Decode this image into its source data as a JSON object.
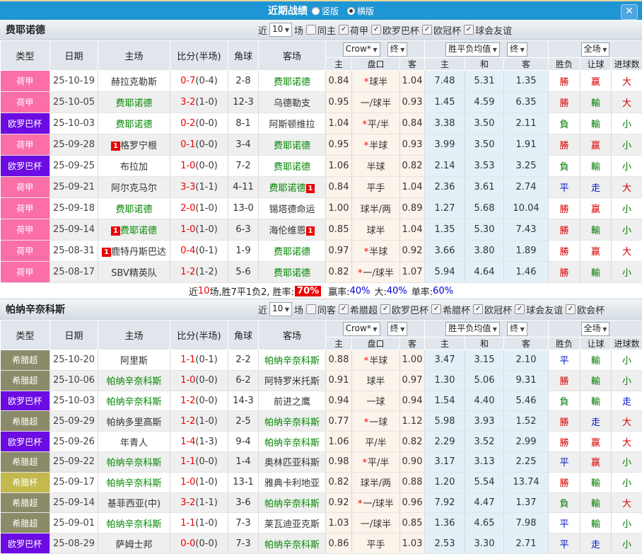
{
  "titlebar": {
    "title": "近期战绩",
    "radios": [
      {
        "label": "竖版",
        "selected": false
      },
      {
        "label": "横版",
        "selected": true
      }
    ],
    "close_icon": "✕"
  },
  "table_header": {
    "type": "类型",
    "date": "日期",
    "home": "主场",
    "score": "比分(半场)",
    "corner": "角球",
    "away": "客场",
    "odds_source_dd": "Crow*",
    "odds_final_dd": "终",
    "avg_dd": "胜平负均值",
    "avg_final_dd": "终",
    "scope_dd": "全场",
    "odds_home": "主",
    "odds_hcap": "盘口",
    "odds_away": "客",
    "avg_home": "主",
    "avg_draw": "和",
    "avg_away": "客",
    "res_wdl": "胜负",
    "res_hcap": "让球",
    "res_goals": "进球数"
  },
  "colors": {
    "topbar": "#2095d3",
    "league_colors": {
      "荷甲": "#fb6ea8",
      "欧罗巴杯": "#6c0ce2",
      "希腊超": "#8b8b69",
      "希腊杯": "#c3b94d"
    },
    "result_colors": {
      "w": "#d40000",
      "l": "#007a00",
      "d": "#0014cc"
    },
    "team_green": "#008800",
    "score_red": "#f00000"
  },
  "sections": [
    {
      "team": "费耶诺德",
      "filter": {
        "near": "近",
        "count": "10",
        "games": "场",
        "same": "同主",
        "same_checked": false,
        "leagues": [
          "荷甲",
          "欧罗巴杯",
          "欧冠杯",
          "球会友谊"
        ]
      },
      "rows": [
        {
          "league": "荷甲",
          "date": "25-10-19",
          "home": "赫拉克勒斯",
          "ft": "0-7",
          "ht": "(0-4)",
          "cr": "2-8",
          "away": "费耶诺德",
          "ag": true,
          "o": [
            "0.84",
            "球半",
            "1.04"
          ],
          "st": true,
          "a": [
            "7.48",
            "5.31",
            "1.35"
          ],
          "r": [
            [
              "勝",
              "w"
            ],
            [
              "赢",
              "w"
            ],
            [
              "大",
              "w"
            ]
          ]
        },
        {
          "league": "荷甲",
          "date": "25-10-05",
          "home": "费耶诺德",
          "hg": true,
          "ft": "3-2",
          "ht": "(1-0)",
          "cr": "12-3",
          "away": "乌德勒支",
          "o": [
            "0.95",
            "一/球半",
            "0.93"
          ],
          "a": [
            "1.45",
            "4.59",
            "6.35"
          ],
          "r": [
            [
              "勝",
              "w"
            ],
            [
              "輸",
              "l"
            ],
            [
              "大",
              "w"
            ]
          ]
        },
        {
          "league": "欧罗巴杯",
          "date": "25-10-03",
          "home": "费耶诺德",
          "hg": true,
          "ft": "0-2",
          "ht": "(0-0)",
          "cr": "8-1",
          "away": "阿斯顿维拉",
          "o": [
            "1.04",
            "平/半",
            "0.84"
          ],
          "st": true,
          "a": [
            "3.38",
            "3.50",
            "2.11"
          ],
          "r": [
            [
              "負",
              "l"
            ],
            [
              "輸",
              "l"
            ],
            [
              "小",
              "l"
            ]
          ]
        },
        {
          "league": "荷甲",
          "date": "25-09-28",
          "home": "格罗宁根",
          "hb": "1",
          "ft": "0-1",
          "ht": "(0-0)",
          "cr": "3-4",
          "away": "费耶诺德",
          "ag": true,
          "o": [
            "0.95",
            "半球",
            "0.93"
          ],
          "st": true,
          "a": [
            "3.99",
            "3.50",
            "1.91"
          ],
          "r": [
            [
              "勝",
              "w"
            ],
            [
              "赢",
              "w"
            ],
            [
              "小",
              "l"
            ]
          ]
        },
        {
          "league": "欧罗巴杯",
          "date": "25-09-25",
          "home": "布拉加",
          "ft": "1-0",
          "ht": "(0-0)",
          "cr": "7-2",
          "away": "费耶诺德",
          "ag": true,
          "o": [
            "1.06",
            "半球",
            "0.82"
          ],
          "a": [
            "2.14",
            "3.53",
            "3.25"
          ],
          "r": [
            [
              "負",
              "l"
            ],
            [
              "輸",
              "l"
            ],
            [
              "小",
              "l"
            ]
          ]
        },
        {
          "league": "荷甲",
          "date": "25-09-21",
          "home": "阿尔克马尔",
          "ft": "3-3",
          "ht": "(1-1)",
          "cr": "4-11",
          "away": "费耶诺德",
          "ag": true,
          "ab": "1",
          "o": [
            "0.84",
            "平手",
            "1.04"
          ],
          "a": [
            "2.36",
            "3.61",
            "2.74"
          ],
          "r": [
            [
              "平",
              "d"
            ],
            [
              "走",
              "d"
            ],
            [
              "大",
              "w"
            ]
          ]
        },
        {
          "league": "荷甲",
          "date": "25-09-18",
          "home": "费耶诺德",
          "hg": true,
          "ft": "2-0",
          "ht": "(1-0)",
          "cr": "13-0",
          "away": "锡塔德命运",
          "o": [
            "1.00",
            "球半/两",
            "0.89"
          ],
          "a": [
            "1.27",
            "5.68",
            "10.04"
          ],
          "r": [
            [
              "勝",
              "w"
            ],
            [
              "赢",
              "w"
            ],
            [
              "小",
              "l"
            ]
          ]
        },
        {
          "league": "荷甲",
          "date": "25-09-14",
          "home": "费耶诺德",
          "hg": true,
          "hb": "1",
          "ft": "1-0",
          "ht": "(1-0)",
          "cr": "6-3",
          "away": "海伦维恩",
          "ab": "1",
          "o": [
            "0.85",
            "球半",
            "1.04"
          ],
          "a": [
            "1.35",
            "5.30",
            "7.43"
          ],
          "r": [
            [
              "勝",
              "w"
            ],
            [
              "輸",
              "l"
            ],
            [
              "小",
              "l"
            ]
          ]
        },
        {
          "league": "荷甲",
          "date": "25-08-31",
          "home": "鹿特丹斯巴达",
          "hb": "1",
          "ft": "0-4",
          "ht": "(0-1)",
          "cr": "1-9",
          "away": "费耶诺德",
          "ag": true,
          "o": [
            "0.97",
            "半球",
            "0.92"
          ],
          "st": true,
          "a": [
            "3.66",
            "3.80",
            "1.89"
          ],
          "r": [
            [
              "勝",
              "w"
            ],
            [
              "赢",
              "w"
            ],
            [
              "大",
              "w"
            ]
          ]
        },
        {
          "league": "荷甲",
          "date": "25-08-17",
          "home": "SBV精英队",
          "ft": "1-2",
          "ht": "(1-2)",
          "cr": "5-6",
          "away": "费耶诺德",
          "ag": true,
          "o": [
            "0.82",
            "一/球半",
            "1.07"
          ],
          "st": true,
          "a": [
            "5.94",
            "4.64",
            "1.46"
          ],
          "r": [
            [
              "勝",
              "w"
            ],
            [
              "輸",
              "l"
            ],
            [
              "小",
              "l"
            ]
          ]
        }
      ],
      "summary": {
        "near": "近",
        "count": "10",
        "mid": "场,胜7平1负2, 胜率:",
        "rate": "70%",
        "pairs": [
          {
            "label": "赢率:",
            "value": "40%"
          },
          {
            "label": "大:",
            "value": "40%"
          },
          {
            "label": "单率:",
            "value": "60%"
          }
        ]
      }
    },
    {
      "team": "帕纳辛奈科斯",
      "filter": {
        "near": "近",
        "count": "10",
        "games": "场",
        "same": "同客",
        "same_checked": false,
        "leagues": [
          "希腊超",
          "欧罗巴杯",
          "希腊杯",
          "欧冠杯",
          "球会友谊",
          "欧会杯"
        ]
      },
      "rows": [
        {
          "league": "希腊超",
          "date": "25-10-20",
          "home": "阿里斯",
          "ft": "1-1",
          "ht": "(0-1)",
          "cr": "2-2",
          "away": "帕纳辛奈科斯",
          "ag": true,
          "o": [
            "0.88",
            "半球",
            "1.00"
          ],
          "st": true,
          "a": [
            "3.47",
            "3.15",
            "2.10"
          ],
          "r": [
            [
              "平",
              "d"
            ],
            [
              "輸",
              "l"
            ],
            [
              "小",
              "l"
            ]
          ]
        },
        {
          "league": "希腊超",
          "date": "25-10-06",
          "home": "帕纳辛奈科斯",
          "hg": true,
          "ft": "1-0",
          "ht": "(0-0)",
          "cr": "6-2",
          "away": "阿特罗米托斯",
          "o": [
            "0.91",
            "球半",
            "0.97"
          ],
          "a": [
            "1.30",
            "5.06",
            "9.31"
          ],
          "r": [
            [
              "勝",
              "w"
            ],
            [
              "輸",
              "l"
            ],
            [
              "小",
              "l"
            ]
          ]
        },
        {
          "league": "欧罗巴杯",
          "date": "25-10-03",
          "home": "帕纳辛奈科斯",
          "hg": true,
          "ft": "1-2",
          "ht": "(0-0)",
          "cr": "14-3",
          "away": "前进之鹰",
          "o": [
            "0.94",
            "一球",
            "0.94"
          ],
          "a": [
            "1.54",
            "4.40",
            "5.46"
          ],
          "r": [
            [
              "負",
              "l"
            ],
            [
              "輸",
              "l"
            ],
            [
              "走",
              "d"
            ]
          ]
        },
        {
          "league": "希腊超",
          "date": "25-09-29",
          "home": "帕纳多里高斯",
          "ft": "1-2",
          "ht": "(1-0)",
          "cr": "2-5",
          "away": "帕纳辛奈科斯",
          "ag": true,
          "o": [
            "0.77",
            "一球",
            "1.12"
          ],
          "st": true,
          "a": [
            "5.98",
            "3.93",
            "1.52"
          ],
          "r": [
            [
              "勝",
              "w"
            ],
            [
              "走",
              "d"
            ],
            [
              "大",
              "w"
            ]
          ]
        },
        {
          "league": "欧罗巴杯",
          "date": "25-09-26",
          "home": "年青人",
          "ft": "1-4",
          "ht": "(1-3)",
          "cr": "9-4",
          "away": "帕纳辛奈科斯",
          "ag": true,
          "o": [
            "1.06",
            "平/半",
            "0.82"
          ],
          "a": [
            "2.29",
            "3.52",
            "2.99"
          ],
          "r": [
            [
              "勝",
              "w"
            ],
            [
              "赢",
              "w"
            ],
            [
              "大",
              "w"
            ]
          ]
        },
        {
          "league": "希腊超",
          "date": "25-09-22",
          "home": "帕纳辛奈科斯",
          "hg": true,
          "ft": "1-1",
          "ht": "(0-0)",
          "cr": "1-4",
          "away": "奥林匹亚科斯",
          "o": [
            "0.98",
            "平/半",
            "0.90"
          ],
          "st": true,
          "a": [
            "3.17",
            "3.13",
            "2.25"
          ],
          "r": [
            [
              "平",
              "d"
            ],
            [
              "赢",
              "w"
            ],
            [
              "小",
              "l"
            ]
          ]
        },
        {
          "league": "希腊杯",
          "date": "25-09-17",
          "home": "帕纳辛奈科斯",
          "hg": true,
          "ft": "1-0",
          "ht": "(1-0)",
          "cr": "13-1",
          "away": "雅典卡利地亚",
          "o": [
            "0.82",
            "球半/两",
            "0.88"
          ],
          "a": [
            "1.20",
            "5.54",
            "13.74"
          ],
          "r": [
            [
              "勝",
              "w"
            ],
            [
              "輸",
              "l"
            ],
            [
              "小",
              "l"
            ]
          ]
        },
        {
          "league": "希腊超",
          "date": "25-09-14",
          "home": "基菲西亚(中)",
          "ft": "3-2",
          "ht": "(1-1)",
          "cr": "3-6",
          "away": "帕纳辛奈科斯",
          "ag": true,
          "o": [
            "0.92",
            "一/球半",
            "0.96"
          ],
          "st": true,
          "a": [
            "7.92",
            "4.47",
            "1.37"
          ],
          "r": [
            [
              "負",
              "l"
            ],
            [
              "輸",
              "l"
            ],
            [
              "大",
              "w"
            ]
          ]
        },
        {
          "league": "希腊超",
          "date": "25-09-01",
          "home": "帕纳辛奈科斯",
          "hg": true,
          "ft": "1-1",
          "ht": "(1-0)",
          "cr": "7-3",
          "away": "莱瓦迪亚克斯",
          "o": [
            "1.03",
            "一/球半",
            "0.85"
          ],
          "a": [
            "1.36",
            "4.65",
            "7.98"
          ],
          "r": [
            [
              "平",
              "d"
            ],
            [
              "輸",
              "l"
            ],
            [
              "小",
              "l"
            ]
          ]
        },
        {
          "league": "欧罗巴杯",
          "date": "25-08-29",
          "home": "萨姆士邦",
          "ft": "0-0",
          "ht": "(0-0)",
          "cr": "7-3",
          "away": "帕纳辛奈科斯",
          "ag": true,
          "o": [
            "0.86",
            "平手",
            "1.03"
          ],
          "a": [
            "2.53",
            "3.30",
            "2.71"
          ],
          "r": [
            [
              "平",
              "d"
            ],
            [
              "走",
              "d"
            ],
            [
              "小",
              "l"
            ]
          ]
        }
      ],
      "summary": null
    }
  ]
}
